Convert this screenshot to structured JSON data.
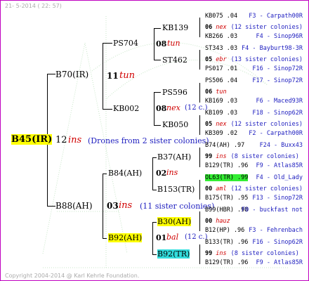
{
  "header": {
    "date": "21-  5-2014 ( 22: 57)",
    "copyright": "Copyright 2004-2014 @ Karl Kehrle Foundation."
  },
  "root": {
    "name": "B45(IR)",
    "year": "12",
    "breed": "ins",
    "note": "(Drones from 2 sister colonies)"
  },
  "gen1": [
    {
      "name": "B70(IR)",
      "year": "11",
      "breed": "tun"
    },
    {
      "name": "B88(AH)",
      "year": "03",
      "breed": "ins",
      "note": "(11 sister colonies)"
    }
  ],
  "gen2": [
    {
      "name": "PS704",
      "year": "08",
      "breed": "tun"
    },
    {
      "name": "KB002",
      "year": "08",
      "breed": "nex",
      "note": "(12 c.)"
    },
    {
      "name": "B84(AH)",
      "year": "02",
      "breed": "ins"
    },
    {
      "name": "B92(AH)",
      "year": "01",
      "breed": "bal",
      "note": "(12 c.)"
    }
  ],
  "gen3": [
    {
      "name": "KB139"
    },
    {
      "name": "ST462"
    },
    {
      "name": "PS596"
    },
    {
      "name": "KB050"
    },
    {
      "name": "B37(AH)"
    },
    {
      "name": "B153(TR)"
    },
    {
      "name": "B30(AH)"
    },
    {
      "name": "B92(TR)"
    }
  ],
  "gen4": [
    {
      "name": "KB075 .04",
      "code": "F3 - Carpath00R"
    },
    {
      "name": "06",
      "breed": "nex",
      "note": "(12 sister colonies)"
    },
    {
      "name": "KB266 .03",
      "code": "F4 - Sinop96R"
    },
    {
      "name": "ST343 .03",
      "code": "F4 - Bayburt98-3R"
    },
    {
      "name": "05",
      "breed": "ebr",
      "note": "(13 sister colonies)"
    },
    {
      "name": "PS017 .01",
      "code": "F16 - Sinop72R"
    },
    {
      "name": "PS506 .04",
      "code": "F17 - Sinop72R"
    },
    {
      "name": "06",
      "breed": "tun",
      "note": ""
    },
    {
      "name": "KB169 .03",
      "code": "F6 - Maced93R"
    },
    {
      "name": "KB109 .03",
      "code": "F18 - Sinop62R"
    },
    {
      "name": "05",
      "breed": "nex",
      "note": "(12 sister colonies)"
    },
    {
      "name": "KB309 .02",
      "code": "F2 - Carpath00R"
    },
    {
      "name": "B74(AH) .97",
      "code": "F24 - Buxx43"
    },
    {
      "name": "99",
      "breed": "ins",
      "note": "(8 sister colonies)"
    },
    {
      "name": "B129(TR) .96",
      "code": "F9 - Atlas85R"
    },
    {
      "name": "OL63(TR) .99",
      "code": "F4 - Old_Lady"
    },
    {
      "name": "00",
      "breed": "aml",
      "note": "(12 sister colonies)"
    },
    {
      "name": "B175(TR) .95",
      "code": "F13 - Sinop72R"
    },
    {
      "name": "B99(HBR) .98",
      "code": "F0 - buckfast not"
    },
    {
      "name": "00",
      "breed": "hauz",
      "note": ""
    },
    {
      "name": "B12(HP) .96",
      "code": "F3 - Fehrenbach"
    },
    {
      "name": "B133(TR) .96",
      "code": "F16 - Sinop62R"
    },
    {
      "name": "99",
      "breed": "ins",
      "note": "(8 sister colonies)"
    },
    {
      "name": "B129(TR) .96",
      "code": "F9 - Atlas85R"
    }
  ]
}
